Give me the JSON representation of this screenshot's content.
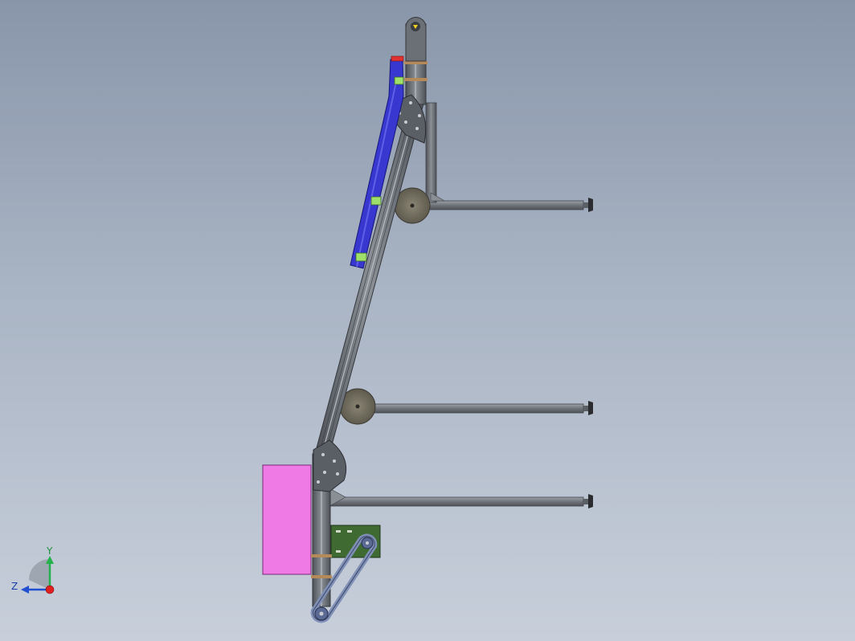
{
  "viewport": {
    "background_top": "#8996aa",
    "background_bottom": "#c8cfdb"
  },
  "model": {
    "components": [
      {
        "name": "conveyor-frame",
        "color": "#6f737a"
      },
      {
        "name": "blue-guide-rail",
        "color": "#3838d0"
      },
      {
        "name": "magenta-panel",
        "color": "#ef7ae6"
      },
      {
        "name": "motor-plate",
        "color": "#3f6b33"
      },
      {
        "name": "drive-belt",
        "color": "#7f8fb6"
      },
      {
        "name": "green-clamps",
        "color": "#9ee06a"
      },
      {
        "name": "red-marker",
        "color": "#e03030"
      },
      {
        "name": "support-legs",
        "color": "#7c8086"
      },
      {
        "name": "leg-pivot-discs",
        "color": "#7a7566"
      }
    ]
  },
  "triad": {
    "y_label": "Y",
    "z_label": "Z",
    "y_color": "#22b14c",
    "z_color": "#2050d0",
    "origin_color": "#e02020"
  }
}
